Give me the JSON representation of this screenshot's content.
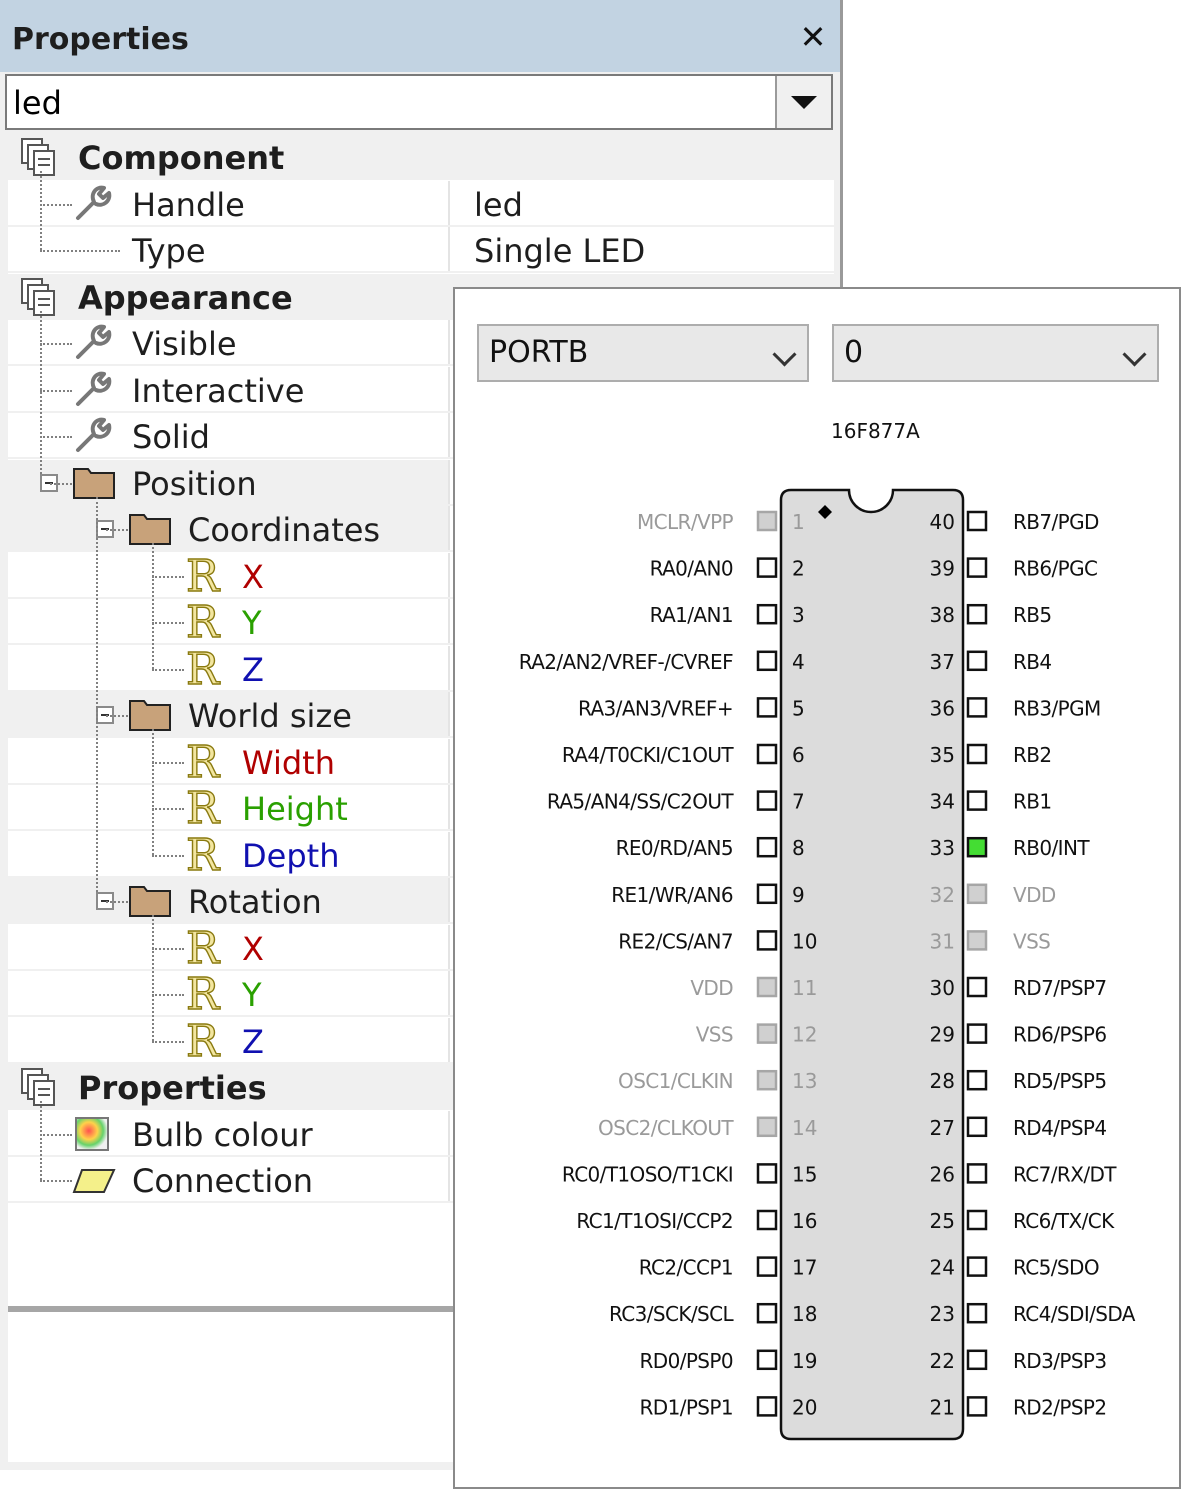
{
  "panel": {
    "title": "Properties",
    "close_glyph": "✕",
    "object_selector": {
      "value": "led"
    }
  },
  "grid": {
    "rows": [
      {
        "id": "component",
        "kind": "category",
        "label": "Component",
        "icon": "category-icon",
        "level": 0
      },
      {
        "id": "handle",
        "kind": "prop",
        "label": "Handle",
        "value": "led",
        "icon": "wrench-icon",
        "level": 1
      },
      {
        "id": "type",
        "kind": "prop",
        "label": "Type",
        "value": "Single LED",
        "icon": "none",
        "level": 1
      },
      {
        "id": "appearance",
        "kind": "category",
        "label": "Appearance",
        "icon": "category-icon",
        "level": 0
      },
      {
        "id": "visible",
        "kind": "prop",
        "label": "Visible",
        "value": "",
        "icon": "wrench-icon",
        "level": 1
      },
      {
        "id": "interactive",
        "kind": "prop",
        "label": "Interactive",
        "value": "",
        "icon": "wrench-icon",
        "level": 1
      },
      {
        "id": "solid",
        "kind": "prop",
        "label": "Solid",
        "value": "",
        "icon": "wrench-icon",
        "level": 1
      },
      {
        "id": "position",
        "kind": "group",
        "label": "Position",
        "icon": "folder-icon",
        "level": 1
      },
      {
        "id": "coordinates",
        "kind": "group",
        "label": "Coordinates",
        "icon": "folder-icon",
        "level": 2
      },
      {
        "id": "coord-x",
        "kind": "prop",
        "label": "X",
        "color": "red",
        "icon": "real-icon",
        "level": 3
      },
      {
        "id": "coord-y",
        "kind": "prop",
        "label": "Y",
        "color": "green",
        "icon": "real-icon",
        "level": 3
      },
      {
        "id": "coord-z",
        "kind": "prop",
        "label": "Z",
        "color": "blue",
        "icon": "real-icon",
        "level": 3
      },
      {
        "id": "world-size",
        "kind": "group",
        "label": "World size",
        "icon": "folder-icon",
        "level": 2
      },
      {
        "id": "width",
        "kind": "prop",
        "label": "Width",
        "color": "red",
        "icon": "real-icon",
        "level": 3
      },
      {
        "id": "height",
        "kind": "prop",
        "label": "Height",
        "color": "green",
        "icon": "real-icon",
        "level": 3
      },
      {
        "id": "depth",
        "kind": "prop",
        "label": "Depth",
        "color": "blue",
        "icon": "real-icon",
        "level": 3
      },
      {
        "id": "rotation",
        "kind": "group",
        "label": "Rotation",
        "icon": "folder-icon",
        "level": 2
      },
      {
        "id": "rot-x",
        "kind": "prop",
        "label": "X",
        "color": "red",
        "icon": "real-icon",
        "level": 3
      },
      {
        "id": "rot-y",
        "kind": "prop",
        "label": "Y",
        "color": "green",
        "icon": "real-icon",
        "level": 3
      },
      {
        "id": "rot-z",
        "kind": "prop",
        "label": "Z",
        "color": "blue",
        "icon": "real-icon",
        "level": 3
      },
      {
        "id": "properties",
        "kind": "category",
        "label": "Properties",
        "icon": "category-icon",
        "level": 0
      },
      {
        "id": "bulb-colour",
        "kind": "prop",
        "label": "Bulb colour",
        "icon": "colour-icon",
        "level": 1
      },
      {
        "id": "connection",
        "kind": "prop",
        "label": "Connection",
        "icon": "connection-icon",
        "level": 1
      }
    ]
  },
  "popup": {
    "port_select": {
      "value": "PORTB"
    },
    "bit_select": {
      "value": "0"
    },
    "chip": {
      "name": "16F877A",
      "left_pins": [
        {
          "num": "1",
          "label": "MCLR/VPP",
          "state": "disabled"
        },
        {
          "num": "2",
          "label": "RA0/AN0",
          "state": "normal"
        },
        {
          "num": "3",
          "label": "RA1/AN1",
          "state": "normal"
        },
        {
          "num": "4",
          "label": "RA2/AN2/VREF-/CVREF",
          "state": "normal"
        },
        {
          "num": "5",
          "label": "RA3/AN3/VREF+",
          "state": "normal"
        },
        {
          "num": "6",
          "label": "RA4/T0CKI/C1OUT",
          "state": "normal"
        },
        {
          "num": "7",
          "label": "RA5/AN4/SS/C2OUT",
          "state": "normal"
        },
        {
          "num": "8",
          "label": "RE0/RD/AN5",
          "state": "normal"
        },
        {
          "num": "9",
          "label": "RE1/WR/AN6",
          "state": "normal"
        },
        {
          "num": "10",
          "label": "RE2/CS/AN7",
          "state": "normal"
        },
        {
          "num": "11",
          "label": "VDD",
          "state": "disabled"
        },
        {
          "num": "12",
          "label": "VSS",
          "state": "disabled"
        },
        {
          "num": "13",
          "label": "OSC1/CLKIN",
          "state": "disabled"
        },
        {
          "num": "14",
          "label": "OSC2/CLKOUT",
          "state": "disabled"
        },
        {
          "num": "15",
          "label": "RC0/T1OSO/T1CKI",
          "state": "normal"
        },
        {
          "num": "16",
          "label": "RC1/T1OSI/CCP2",
          "state": "normal"
        },
        {
          "num": "17",
          "label": "RC2/CCP1",
          "state": "normal"
        },
        {
          "num": "18",
          "label": "RC3/SCK/SCL",
          "state": "normal"
        },
        {
          "num": "19",
          "label": "RD0/PSP0",
          "state": "normal"
        },
        {
          "num": "20",
          "label": "RD1/PSP1",
          "state": "normal"
        }
      ],
      "right_pins": [
        {
          "num": "40",
          "label": "RB7/PGD",
          "state": "normal"
        },
        {
          "num": "39",
          "label": "RB6/PGC",
          "state": "normal"
        },
        {
          "num": "38",
          "label": "RB5",
          "state": "normal"
        },
        {
          "num": "37",
          "label": "RB4",
          "state": "normal"
        },
        {
          "num": "36",
          "label": "RB3/PGM",
          "state": "normal"
        },
        {
          "num": "35",
          "label": "RB2",
          "state": "normal"
        },
        {
          "num": "34",
          "label": "RB1",
          "state": "normal"
        },
        {
          "num": "33",
          "label": "RB0/INT",
          "state": "selected"
        },
        {
          "num": "32",
          "label": "VDD",
          "state": "disabled"
        },
        {
          "num": "31",
          "label": "VSS",
          "state": "disabled"
        },
        {
          "num": "30",
          "label": "RD7/PSP7",
          "state": "normal"
        },
        {
          "num": "29",
          "label": "RD6/PSP6",
          "state": "normal"
        },
        {
          "num": "28",
          "label": "RD5/PSP5",
          "state": "normal"
        },
        {
          "num": "27",
          "label": "RD4/PSP4",
          "state": "normal"
        },
        {
          "num": "26",
          "label": "RC7/RX/DT",
          "state": "normal"
        },
        {
          "num": "25",
          "label": "RC6/TX/CK",
          "state": "normal"
        },
        {
          "num": "24",
          "label": "RC5/SDO",
          "state": "normal"
        },
        {
          "num": "23",
          "label": "RC4/SDI/SDA",
          "state": "normal"
        },
        {
          "num": "22",
          "label": "RD3/PSP3",
          "state": "normal"
        },
        {
          "num": "21",
          "label": "RD2/PSP2",
          "state": "normal"
        }
      ]
    }
  },
  "colors": {
    "title_bar": "#c2d3e2",
    "pin_selected": "#44dd33",
    "pin_disabled_text": "#9a9a9a",
    "chip_body": "#dcdcdc",
    "red_label": "#b00000",
    "green_label": "#2aa000",
    "blue_label": "#1010b0"
  }
}
